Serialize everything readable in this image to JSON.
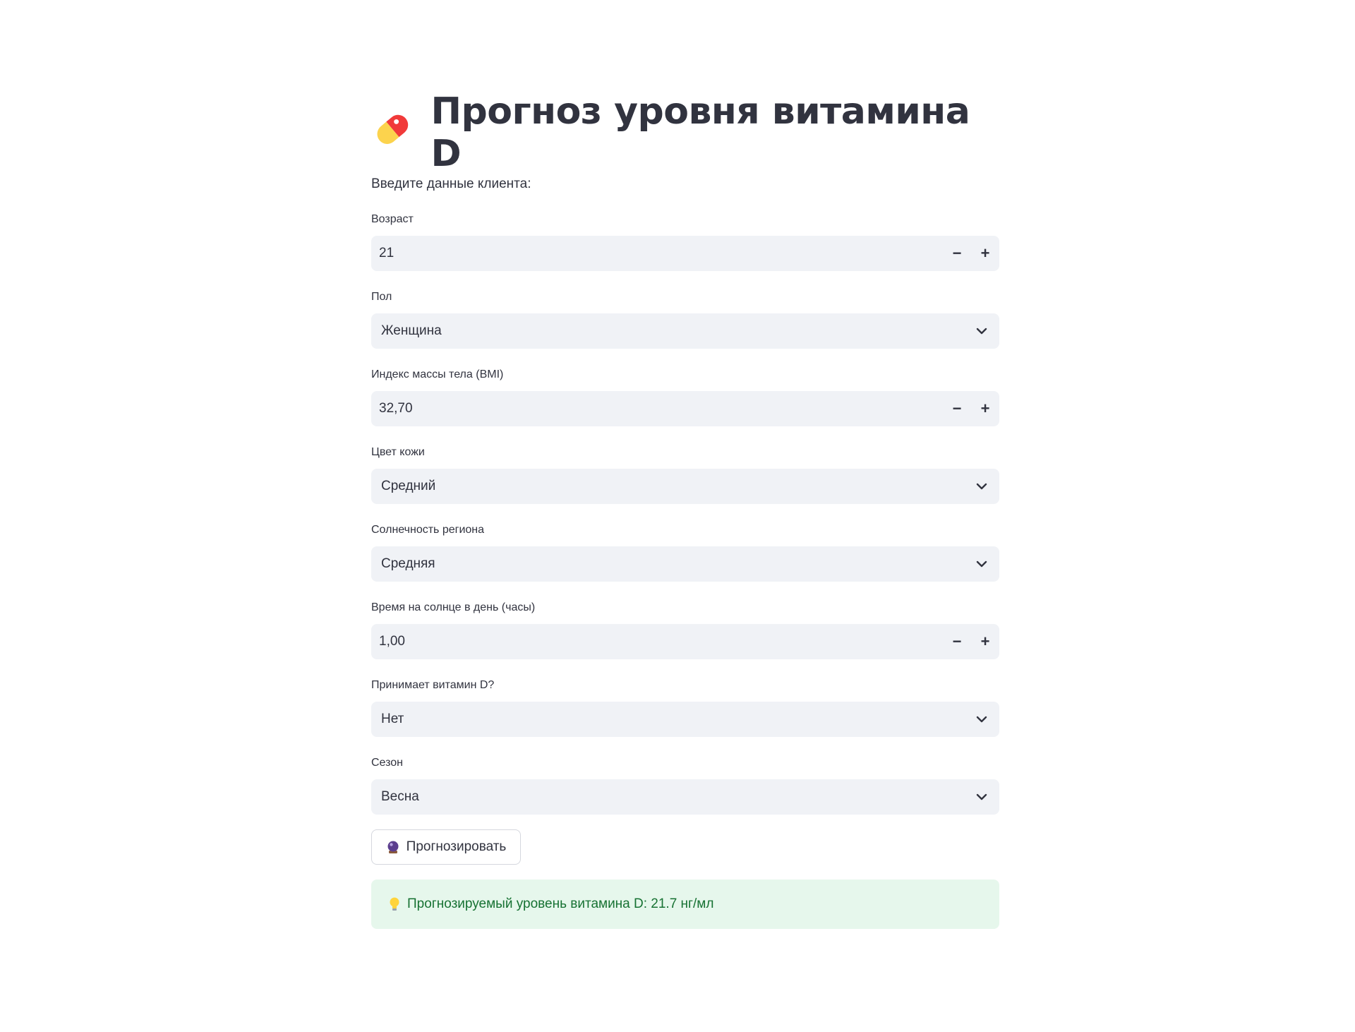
{
  "page": {
    "title": "Прогноз уровня витамина D",
    "title_icon": "pill-icon",
    "intro": "Введите данные клиента:"
  },
  "fields": {
    "age": {
      "label": "Возраст",
      "value": "21",
      "type": "number"
    },
    "sex": {
      "label": "Пол",
      "value": "Женщина",
      "type": "select"
    },
    "bmi": {
      "label": "Индекс массы тела (BMI)",
      "value": "32,70",
      "type": "number"
    },
    "skin": {
      "label": "Цвет кожи",
      "value": "Средний",
      "type": "select"
    },
    "sun_region": {
      "label": "Солнечность региона",
      "value": "Средняя",
      "type": "select"
    },
    "sun_time": {
      "label": "Время на солнце в день (часы)",
      "value": "1,00",
      "type": "number"
    },
    "supplement": {
      "label": "Принимает витамин D?",
      "value": "Нет",
      "type": "select"
    },
    "season": {
      "label": "Сезон",
      "value": "Весна",
      "type": "select"
    }
  },
  "stepper": {
    "minus": "−",
    "plus": "+"
  },
  "actions": {
    "predict_label": "Прогнозировать",
    "predict_icon": "crystal-ball-icon"
  },
  "result": {
    "icon": "light-bulb-icon",
    "text": "Прогнозируемый уровень витамина D: 21.7 нг/мл"
  },
  "colors": {
    "text": "#31333f",
    "input_bg": "#f0f2f6",
    "success_bg": "#e6f7ec",
    "success_text": "#177233"
  }
}
